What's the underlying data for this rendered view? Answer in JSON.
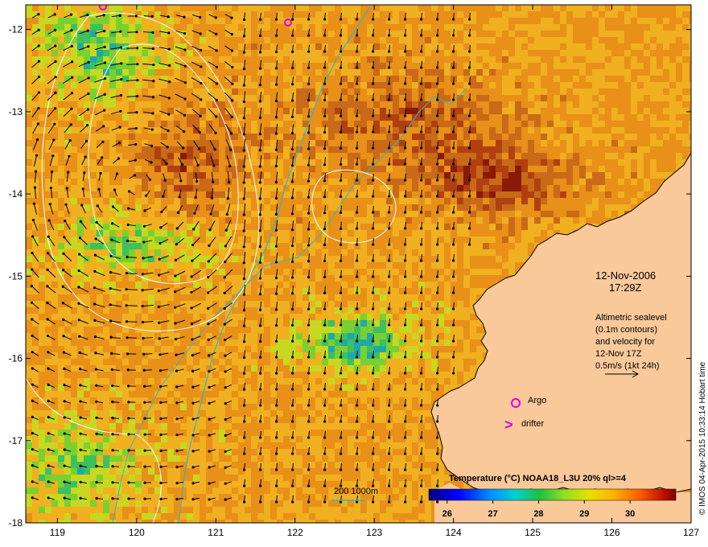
{
  "map": {
    "lon_range": [
      118.6,
      127
    ],
    "lat_range": [
      -18,
      -11.7
    ],
    "x_ticks": [
      "119",
      "120",
      "121",
      "122",
      "123",
      "124",
      "125",
      "126",
      "127"
    ],
    "y_ticks": [
      "-12",
      "-13",
      "-14",
      "-15",
      "-16",
      "-17",
      "-18"
    ],
    "colors": {
      "land": "#f9c99a",
      "coast": "#000000",
      "contour": "#ffffff",
      "bathy": "#2fb8c0",
      "marker": "#e000e0",
      "arrow": "#000000"
    }
  },
  "annotations": {
    "date": "12-Nov-2006",
    "time": "17:29Z",
    "legend_line1": "Altimetric sealevel",
    "legend_line2": "(0.1m contours)",
    "legend_line3": "and velocity for",
    "legend_line4": "12-Nov 17Z",
    "legend_line5": "0.5m/s (1kt 24h)",
    "argo_label": "Argo",
    "drifter_label": "drifter",
    "drifter_symbol": ">",
    "bathy_label": "200  1000m"
  },
  "colorbar": {
    "title": "Temperature (°C) NOAA18_L3U 20% ql>=4",
    "ticks": [
      "26",
      "27",
      "28",
      "29",
      "30"
    ],
    "range": [
      25.6,
      31.0
    ]
  },
  "credit": "© IMOS 04-Apr-2015 10:33:14 Hobart time"
}
